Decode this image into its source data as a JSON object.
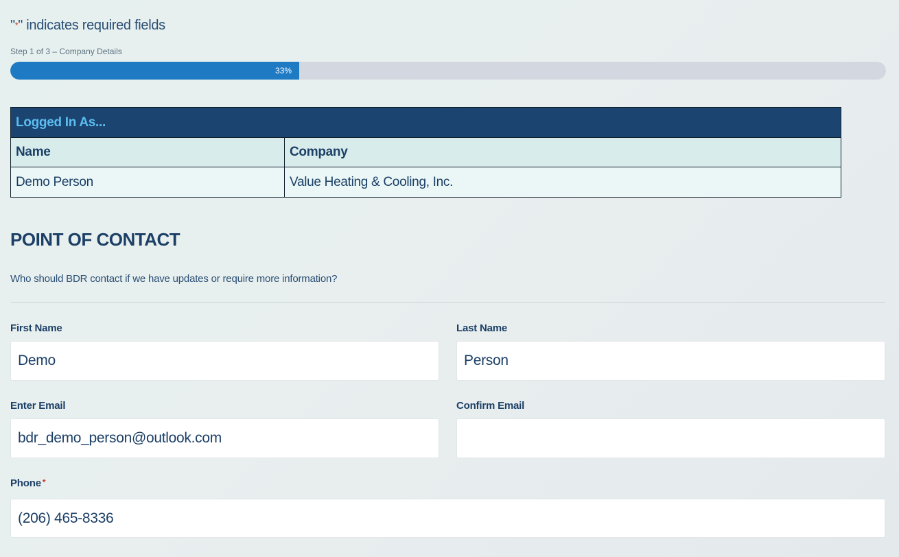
{
  "form": {
    "required_note_prefix": "\"",
    "required_note_star": "*",
    "required_note_suffix": "\" indicates required fields",
    "step_label": "Step 1 of 3 – Company Details",
    "progress_text": "33%",
    "progress_fraction": 0.33,
    "colors": {
      "progress_fill": "#1f7ac4",
      "required_star": "#c0392b",
      "table_title_bg": "#1b4470",
      "table_title_text": "#5bbdf0"
    }
  },
  "logged_in": {
    "title": "Logged In As...",
    "headers": [
      "Name",
      "Company"
    ],
    "row": [
      "Demo Person",
      "Value Heating & Cooling, Inc."
    ]
  },
  "point_of_contact": {
    "title": "POINT OF CONTACT",
    "description": "Who should BDR contact if we have updates or require more information?",
    "fields": {
      "first_name": {
        "label": "First Name",
        "value": "Demo"
      },
      "last_name": {
        "label": "Last Name",
        "value": "Person"
      },
      "enter_email": {
        "label": "Enter Email",
        "value": "bdr_demo_person@outlook.com"
      },
      "confirm_email": {
        "label": "Confirm Email",
        "value": ""
      },
      "phone": {
        "label": "Phone",
        "required_star": "*",
        "value": "(206) 465-8336"
      }
    }
  }
}
